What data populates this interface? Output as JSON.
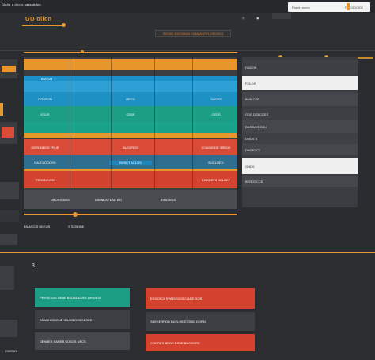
{
  "topbar": {
    "title": "Dlabo u dbo.o sasssbdpo",
    "nav": [
      "IN CO",
      "ELONDR"
    ],
    "search_placeholder": "Papdn aomo",
    "search_right": "PHOSDOEU"
  },
  "header": {
    "logo": "GO olion",
    "banner": "WICHO ESCNBAN CAMAN ITEL SEGED3"
  },
  "table": {
    "rows": [
      {
        "cells": [
          "",
          "",
          "",
          "",
          ""
        ],
        "color": "#e8962c"
      },
      {
        "cells": [
          "BUCUN",
          "",
          "",
          "",
          ""
        ],
        "color": "#1a8fc9"
      },
      {
        "cells": [
          "OOSRON",
          "",
          "BECO",
          "",
          "SAKOS"
        ],
        "color": "#1e91c4"
      },
      {
        "cells": [
          "ESUS",
          "",
          "CEBS",
          "",
          "CEDS"
        ],
        "color": "#1e9a86"
      },
      {
        "cells": [
          "",
          "",
          "",
          "",
          ""
        ],
        "color": "#1aa28a"
      },
      {
        "cells": [
          "DERONDOS FRUE",
          "",
          "BUCEROS",
          "",
          "COAS/IODE SREDE"
        ],
        "color": "#d94b37"
      },
      {
        "cells": [
          "DAJCLODORS",
          "",
          "BHSET ACLOS",
          "",
          "BUCLOED"
        ],
        "color": "#1f84ba"
      },
      {
        "cells": [
          "TREISDEVRO",
          "",
          "",
          "",
          "BOODRT3 CALUEF"
        ],
        "color": "#d3432f"
      }
    ],
    "footer_left": "DAORS   BOS",
    "footer_right": "DSMBOO ESD BO",
    "footer_mid": "DNO VDS"
  },
  "side": {
    "items": [
      "DADON",
      "FOLDS",
      "BUN COE",
      "GDS DEBCCES",
      "BEODGR EGU",
      "DNOS S",
      "DAOENFE",
      "GNDS",
      "BEROSCCE"
    ]
  },
  "lower": {
    "left_label": "BS ASCIS BDEOS",
    "mid_label": "S    SCBOBE",
    "section_icon": "3",
    "cards_left": [
      "PRHSESDE BEAB BEDADUUES DRSNOS",
      "BSAGHSDIONE 90USB DSSOBSRE",
      "DENBEB SAREB SOSOS NSCS"
    ],
    "cards_right": [
      "ERGOSOI SWNSEDOEC ADE GOR",
      "SBEKERRDD BUELHE EEDBC DORN",
      "COORES BDOE ESSE  BDCOORE"
    ],
    "bottom_left": "CSEBIO"
  },
  "colors": {
    "orange": "#e8962c",
    "blue": "#1e91c4",
    "teal": "#1b9e84",
    "red": "#d5432f"
  }
}
